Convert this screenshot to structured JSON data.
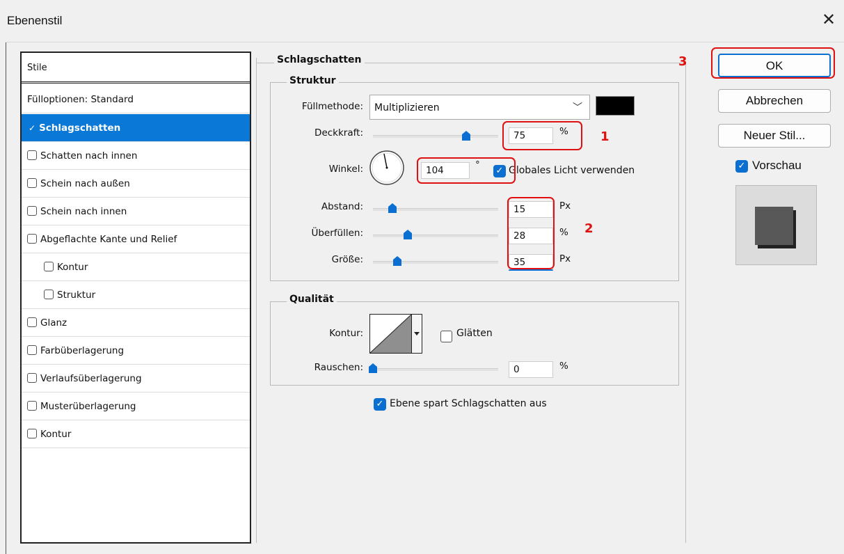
{
  "window": {
    "title": "Ebenenstil",
    "close": "✕"
  },
  "styles_panel": {
    "header": "Stile",
    "items": [
      {
        "label": "Fülloptionen: Standard",
        "checkbox": false
      },
      {
        "label": "Schlagschatten",
        "checkbox": true,
        "selected": true,
        "checked": true
      },
      {
        "label": "Schatten nach innen",
        "checkbox": true
      },
      {
        "label": "Schein nach außen",
        "checkbox": true
      },
      {
        "label": "Schein nach innen",
        "checkbox": true
      },
      {
        "label": "Abgeflachte Kante und Relief",
        "checkbox": true
      },
      {
        "label": "Kontur",
        "checkbox": true,
        "indent": true
      },
      {
        "label": "Struktur",
        "checkbox": true,
        "indent": true
      },
      {
        "label": "Glanz",
        "checkbox": true
      },
      {
        "label": "Farbüberlagerung",
        "checkbox": true
      },
      {
        "label": "Verlaufsüberlagerung",
        "checkbox": true
      },
      {
        "label": "Musterüberlagerung",
        "checkbox": true
      },
      {
        "label": "Kontur",
        "checkbox": true
      }
    ]
  },
  "main": {
    "section_title": "Schlagschatten",
    "structure": {
      "title": "Struktur",
      "fill_method_label": "Füllmethode:",
      "fill_method_value": "Multiplizieren",
      "shadow_color": "#000000",
      "opacity_label": "Deckkraft:",
      "opacity_value": "75",
      "opacity_unit": "%",
      "opacity_level": 0.75,
      "angle_label": "Winkel:",
      "angle_value": "104",
      "angle_unit": "°",
      "global_light_label": "Globales Licht verwenden",
      "global_light_checked": true,
      "distance_label": "Abstand:",
      "distance_value": "15",
      "distance_unit": "Px",
      "spread_label": "Überfüllen:",
      "spread_value": "28",
      "spread_unit": "%",
      "size_label": "Größe:",
      "size_value": "35",
      "size_unit": "Px"
    },
    "quality": {
      "title": "Qualität",
      "contour_label": "Kontur:",
      "smooth_label": "Glätten",
      "smooth_checked": false,
      "noise_label": "Rauschen:",
      "noise_value": "0",
      "noise_unit": "%"
    },
    "knockout_label": "Ebene spart Schlagschatten aus",
    "knockout_checked": true
  },
  "annotations": {
    "one": "1",
    "two": "2",
    "three": "3",
    "color": "#e01010"
  },
  "buttons": {
    "ok": "OK",
    "cancel": "Abbrechen",
    "new_style": "Neuer Stil...",
    "preview_label": "Vorschau",
    "preview_checked": true
  },
  "accent_color": "#0a78d7"
}
